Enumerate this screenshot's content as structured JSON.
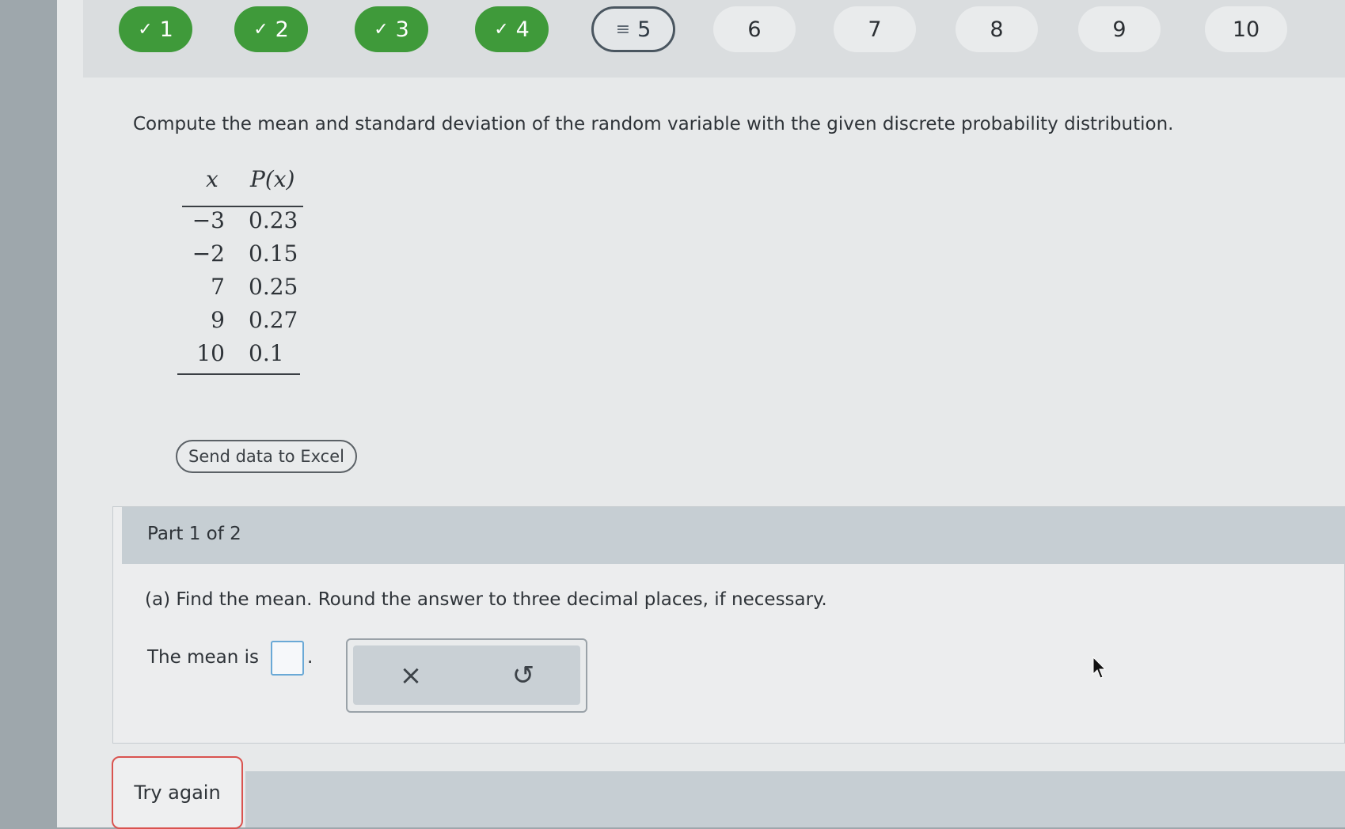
{
  "steps": [
    {
      "label": "1",
      "state": "done"
    },
    {
      "label": "2",
      "state": "done"
    },
    {
      "label": "3",
      "state": "done"
    },
    {
      "label": "4",
      "state": "done"
    },
    {
      "label": "5",
      "state": "current"
    },
    {
      "label": "6",
      "state": "todo"
    },
    {
      "label": "7",
      "state": "todo"
    },
    {
      "label": "8",
      "state": "todo"
    },
    {
      "label": "9",
      "state": "todo"
    },
    {
      "label": "10",
      "state": "todo"
    }
  ],
  "question": {
    "text": "Compute the mean and standard deviation of the random variable with the given discrete probability distribution."
  },
  "distribution": {
    "headers": {
      "x": "x",
      "p": "P(x)"
    },
    "rows": [
      {
        "x": "−3",
        "p": "0.23"
      },
      {
        "x": "−2",
        "p": "0.15"
      },
      {
        "x": "7",
        "p": "0.25"
      },
      {
        "x": "9",
        "p": "0.27"
      },
      {
        "x": "10",
        "p": "0.1"
      }
    ]
  },
  "excel_button": {
    "label": "Send data to Excel"
  },
  "part": {
    "label": "Part 1 of 2",
    "prompt": "(a) Find the mean. Round the answer to three decimal places, if necessary.",
    "answer_label": "The mean is",
    "answer_value": "",
    "period": "."
  },
  "tools": {
    "clear_symbol": "×",
    "undo_symbol": "↺"
  },
  "try_again": {
    "label": "Try again"
  },
  "colors": {
    "done": "#3f9a3a",
    "error": "#d9534f",
    "focus": "#6aa9d6"
  }
}
